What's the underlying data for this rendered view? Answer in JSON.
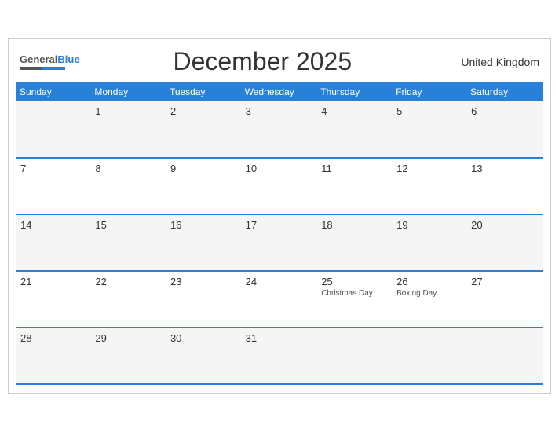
{
  "header": {
    "logo_general": "General",
    "logo_blue": "Blue",
    "title": "December 2025",
    "country": "United Kingdom"
  },
  "weekdays": [
    "Sunday",
    "Monday",
    "Tuesday",
    "Wednesday",
    "Thursday",
    "Friday",
    "Saturday"
  ],
  "weeks": [
    [
      {
        "day": "",
        "holiday": ""
      },
      {
        "day": "1",
        "holiday": ""
      },
      {
        "day": "2",
        "holiday": ""
      },
      {
        "day": "3",
        "holiday": ""
      },
      {
        "day": "4",
        "holiday": ""
      },
      {
        "day": "5",
        "holiday": ""
      },
      {
        "day": "6",
        "holiday": ""
      }
    ],
    [
      {
        "day": "7",
        "holiday": ""
      },
      {
        "day": "8",
        "holiday": ""
      },
      {
        "day": "9",
        "holiday": ""
      },
      {
        "day": "10",
        "holiday": ""
      },
      {
        "day": "11",
        "holiday": ""
      },
      {
        "day": "12",
        "holiday": ""
      },
      {
        "day": "13",
        "holiday": ""
      }
    ],
    [
      {
        "day": "14",
        "holiday": ""
      },
      {
        "day": "15",
        "holiday": ""
      },
      {
        "day": "16",
        "holiday": ""
      },
      {
        "day": "17",
        "holiday": ""
      },
      {
        "day": "18",
        "holiday": ""
      },
      {
        "day": "19",
        "holiday": ""
      },
      {
        "day": "20",
        "holiday": ""
      }
    ],
    [
      {
        "day": "21",
        "holiday": ""
      },
      {
        "day": "22",
        "holiday": ""
      },
      {
        "day": "23",
        "holiday": ""
      },
      {
        "day": "24",
        "holiday": ""
      },
      {
        "day": "25",
        "holiday": "Christmas Day"
      },
      {
        "day": "26",
        "holiday": "Boxing Day"
      },
      {
        "day": "27",
        "holiday": ""
      }
    ],
    [
      {
        "day": "28",
        "holiday": ""
      },
      {
        "day": "29",
        "holiday": ""
      },
      {
        "day": "30",
        "holiday": ""
      },
      {
        "day": "31",
        "holiday": ""
      },
      {
        "day": "",
        "holiday": ""
      },
      {
        "day": "",
        "holiday": ""
      },
      {
        "day": "",
        "holiday": ""
      }
    ]
  ]
}
